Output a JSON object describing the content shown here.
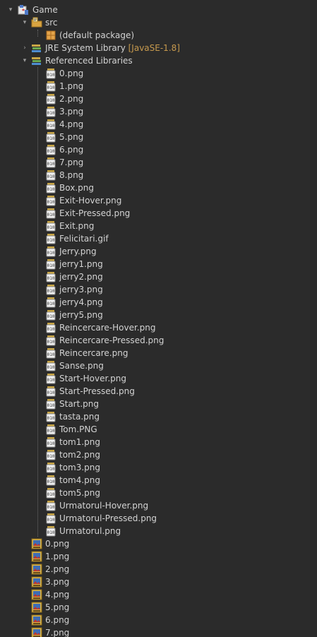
{
  "project": {
    "name": "Game",
    "src_label": "src",
    "default_package_label": "(default package)",
    "jre_label": "JRE System Library",
    "jre_decoration": "[JavaSE-1.8]",
    "ref_libs_label": "Referenced Libraries"
  },
  "referenced_files": [
    "0.png",
    "1.png",
    "2.png",
    "3.png",
    "4.png",
    "5.png",
    "6.png",
    "7.png",
    "8.png",
    "Box.png",
    "Exit-Hover.png",
    "Exit-Pressed.png",
    "Exit.png",
    "Felicitari.gif",
    "Jerry.png",
    "jerry1.png",
    "jerry2.png",
    "jerry3.png",
    "jerry4.png",
    "jerry5.png",
    "Reincercare-Hover.png",
    "Reincercare-Pressed.png",
    "Reincercare.png",
    "Sanse.png",
    "Start-Hover.png",
    "Start-Pressed.png",
    "Start.png",
    "tasta.png",
    "Tom.PNG",
    "tom1.png",
    "tom2.png",
    "tom3.png",
    "tom4.png",
    "tom5.png",
    "Urmatorul-Hover.png",
    "Urmatorul-Pressed.png",
    "Urmatorul.png"
  ],
  "project_files": [
    "0.png",
    "1.png",
    "2.png",
    "3.png",
    "4.png",
    "5.png",
    "6.png",
    "7.png"
  ],
  "icons": {
    "project": "java-project-icon",
    "src": "source-folder-icon",
    "package": "package-icon",
    "library": "library-icon",
    "jar": "jar-file-icon",
    "image": "image-file-icon"
  },
  "colors": {
    "background": "#2b2b2b",
    "text": "#d3d3d3",
    "decoration": "#c79a4e"
  }
}
